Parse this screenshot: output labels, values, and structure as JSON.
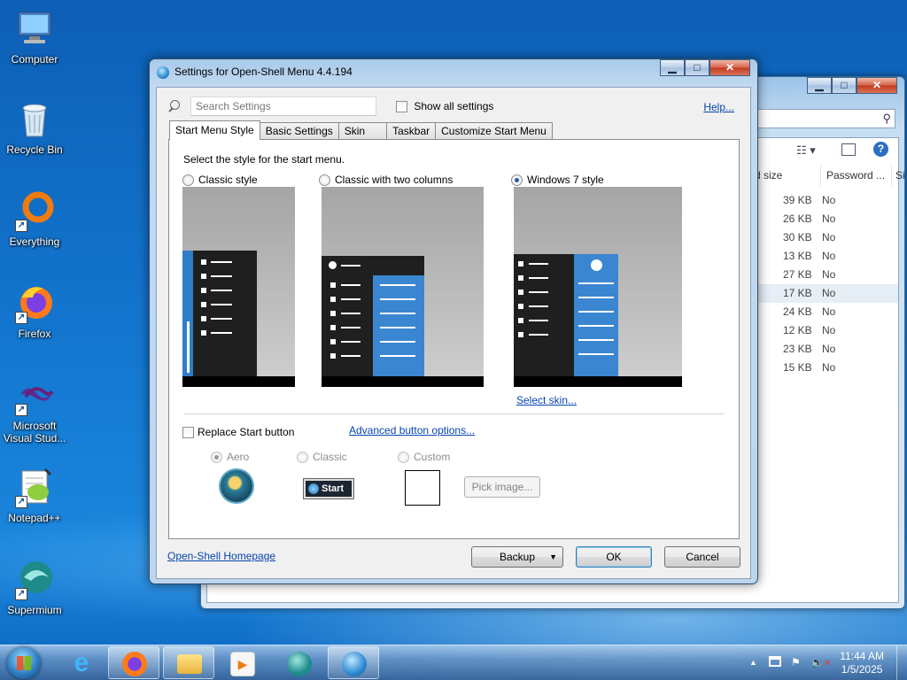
{
  "desktop": {
    "icons": [
      {
        "label": "Computer",
        "icon": "computer-icon"
      },
      {
        "label": "Recycle Bin",
        "icon": "recycle-bin-icon"
      },
      {
        "label": "Everything",
        "icon": "everything-icon"
      },
      {
        "label": "Firefox",
        "icon": "firefox-icon"
      },
      {
        "label": "Microsoft Visual Stud...",
        "icon": "visual-studio-icon"
      },
      {
        "label": "Notepad++",
        "icon": "notepad-plus-plus-icon"
      },
      {
        "label": "Supermium",
        "icon": "supermium-icon"
      }
    ]
  },
  "explorer": {
    "columns": [
      "d size",
      "Password ...",
      "Si"
    ],
    "rows": [
      {
        "size": "39 KB",
        "password": "No"
      },
      {
        "size": "26 KB",
        "password": "No"
      },
      {
        "size": "30 KB",
        "password": "No"
      },
      {
        "size": "13 KB",
        "password": "No"
      },
      {
        "size": "27 KB",
        "password": "No"
      },
      {
        "size": "17 KB",
        "password": "No"
      },
      {
        "size": "24 KB",
        "password": "No"
      },
      {
        "size": "12 KB",
        "password": "No"
      },
      {
        "size": "23 KB",
        "password": "No"
      },
      {
        "size": "15 KB",
        "password": "No"
      }
    ],
    "buttons": {
      "minimize": "▁",
      "maximize": "□",
      "close": "✕"
    }
  },
  "dialog": {
    "title": "Settings for Open-Shell Menu 4.4.194",
    "search_placeholder": "Search Settings",
    "show_all": "Show all settings",
    "help": "Help...",
    "tabs": [
      "Start Menu Style",
      "Basic Settings",
      "Skin",
      "Taskbar",
      "Customize Start Menu"
    ],
    "instruction": "Select the style for the start menu.",
    "styles": [
      {
        "label": "Classic style",
        "selected": false
      },
      {
        "label": "Classic with two columns",
        "selected": false
      },
      {
        "label": "Windows 7 style",
        "selected": true
      }
    ],
    "select_skin": "Select skin...",
    "replace_start": "Replace Start button",
    "advanced_button": "Advanced button options...",
    "button_styles": [
      {
        "label": "Aero",
        "selected": true
      },
      {
        "label": "Classic",
        "selected": false
      },
      {
        "label": "Custom",
        "selected": false
      }
    ],
    "classic_button_text": "Start",
    "pick_image": "Pick image...",
    "homepage": "Open-Shell Homepage",
    "backup": "Backup",
    "ok": "OK",
    "cancel": "Cancel",
    "buttons": {
      "minimize": "▁",
      "maximize": "□",
      "close": "✕"
    }
  },
  "taskbar": {
    "time": "11:44 AM",
    "date": "1/5/2025",
    "tray_arrow": "▲"
  }
}
